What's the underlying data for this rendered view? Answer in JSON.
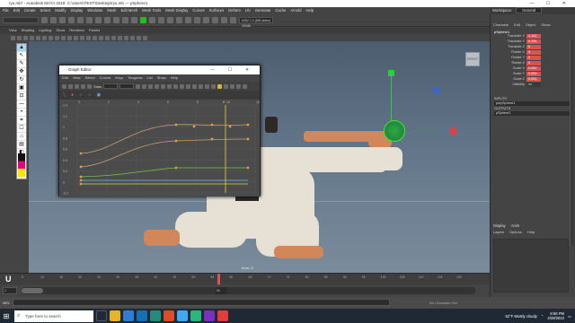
{
  "window": {
    "title": "ryu.mb* - Autodesk MAYA 2018: C:\\Users\\TEST\\Desktop\\ryu.mb --- pSphere1",
    "controls": "— ☐ ✕"
  },
  "menu": [
    "File",
    "Edit",
    "Create",
    "Select",
    "Modify",
    "Display",
    "Windows",
    "Mesh",
    "Edit Mesh",
    "Mesh Tools",
    "Mesh Display",
    "Curves",
    "Surfaces",
    "Deform",
    "UV",
    "Generate",
    "Cache",
    "Arnold",
    "Help"
  ],
  "workspace": {
    "label": "Workspace:",
    "value": "General"
  },
  "shelf": {
    "field": "#252 1.0 (600 sides) (2048)"
  },
  "panel_menu": [
    "View",
    "Shading",
    "Lighting",
    "Show",
    "Renderer",
    "Panels"
  ],
  "tools": [
    "▲",
    "↖",
    "✎",
    "✥",
    "↻",
    "▣",
    "⊡",
    "—",
    "•",
    "⌗",
    "☐",
    "⌂",
    "▤",
    "◧"
  ],
  "viewport": {
    "camera": "front -Z",
    "cube": "FRONT"
  },
  "graph_editor": {
    "title": "Graph Editor",
    "controls": "— ☐ ✕",
    "menu": [
      "Edit",
      "View",
      "Select",
      "Curves",
      "Keys",
      "Tangents",
      "List",
      "Show",
      "Help"
    ],
    "stats_label": "Stats",
    "y_ticks": [
      "1.4",
      "1.2",
      "1",
      "0.8",
      "0.6",
      "0.4",
      "0.2",
      "0",
      "-0.2"
    ],
    "x_ticks": [
      "0",
      "2",
      "4",
      "6",
      "8",
      "10",
      "12"
    ],
    "current_frame": "8"
  },
  "timeline": {
    "logo": "U",
    "ticks": [
      "5",
      "10",
      "15",
      "20",
      "25",
      "30",
      "35",
      "40",
      "45",
      "50",
      "55",
      "60",
      "65",
      "70",
      "75",
      "80",
      "85",
      "90",
      "95",
      "100",
      "105",
      "110",
      "115",
      "120"
    ]
  },
  "range": {
    "start": "1",
    "inner_start": "1",
    "inner_end": "120",
    "end": "200",
    "current": "50"
  },
  "cmdline": {
    "label": "MEL",
    "char_set": "No Character Set",
    "anim_layer": "No Anim Layer"
  },
  "channel_box": {
    "tabs": [
      "Channels",
      "Edit",
      "Object",
      "Show"
    ],
    "object": "pSphere1",
    "attributes": [
      {
        "name": "Translate X",
        "value": "1.141",
        "keyed": true
      },
      {
        "name": "Translate Y",
        "value": "0.284",
        "keyed": true
      },
      {
        "name": "Translate Z",
        "value": "0",
        "keyed": true
      },
      {
        "name": "Rotate X",
        "value": "0",
        "keyed": true
      },
      {
        "name": "Rotate Y",
        "value": "0",
        "keyed": true
      },
      {
        "name": "Rotate Z",
        "value": "0",
        "keyed": true
      },
      {
        "name": "Scale X",
        "value": "0.051",
        "keyed": true
      },
      {
        "name": "Scale Y",
        "value": "0.051",
        "keyed": true
      },
      {
        "name": "Scale Z",
        "value": "0.051",
        "keyed": true
      },
      {
        "name": "Visibility",
        "value": "on",
        "keyed": false
      }
    ],
    "inputs_label": "INPUTS",
    "inputs": [
      "polySphere1"
    ],
    "outputs_label": "OUTPUTS",
    "outputs": [
      "pSphere1"
    ]
  },
  "display_panel": {
    "tabs": [
      "Display",
      "Anim"
    ],
    "menu": [
      "Layers",
      "Options",
      "Help"
    ]
  },
  "taskbar": {
    "search": "Type here to search",
    "weather": "52°F  Mostly cloudy",
    "time": "8:56 PM",
    "date": "4/28/2022"
  },
  "colors": {
    "accent": "#19c219",
    "keyed": "#d9534f",
    "timeline_marker": "#d9534f",
    "graph_curve_red": "#c8a070",
    "graph_curve_green": "#7fbf4f"
  }
}
